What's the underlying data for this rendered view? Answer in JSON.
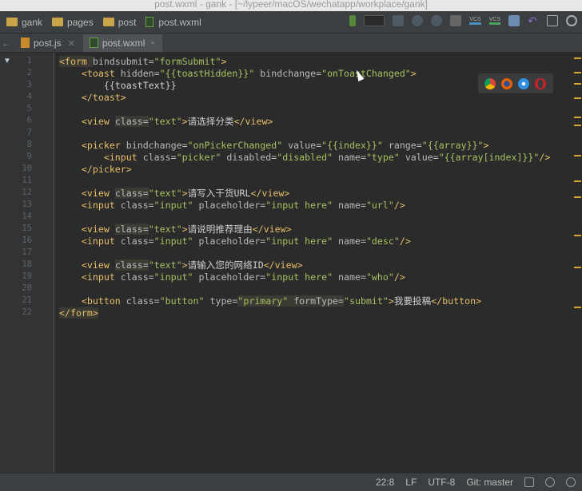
{
  "window": {
    "title": "post.wxml - gank - [~/lypeer/macOS/wechatapp/workplace/gank]"
  },
  "breadcrumb": [
    "gank",
    "pages",
    "post",
    "post.wxml"
  ],
  "tabs": [
    {
      "label": "post.js",
      "active": false
    },
    {
      "label": "post.wxml",
      "active": true
    }
  ],
  "toolbar": {
    "vcs_update": "VCS",
    "vcs_commit": "VCS"
  },
  "code": [
    [
      {
        "t": "<form ",
        "c": "tag hl"
      },
      {
        "t": "bindsubmit=",
        "c": "attr"
      },
      {
        "t": "\"formSubmit\"",
        "c": "str"
      },
      {
        "t": ">",
        "c": "tag"
      }
    ],
    [
      {
        "t": "    <toast ",
        "c": "tag"
      },
      {
        "t": "hidden=",
        "c": "attr"
      },
      {
        "t": "\"{{toastHidden}}\"",
        "c": "str"
      },
      {
        "t": " bindchange=",
        "c": "attr"
      },
      {
        "t": "\"onToastChanged\"",
        "c": "str"
      },
      {
        "t": ">",
        "c": "tag"
      }
    ],
    [
      {
        "t": "        {{toastText}}",
        "c": "txt"
      }
    ],
    [
      {
        "t": "    </toast>",
        "c": "tag"
      }
    ],
    [],
    [
      {
        "t": "    <view ",
        "c": "tag"
      },
      {
        "t": "class=",
        "c": "attr hl"
      },
      {
        "t": "\"text\"",
        "c": "str"
      },
      {
        "t": ">",
        "c": "tag"
      },
      {
        "t": "请选择分类",
        "c": "txt"
      },
      {
        "t": "</view>",
        "c": "tag"
      }
    ],
    [],
    [
      {
        "t": "    <picker ",
        "c": "tag"
      },
      {
        "t": "bindchange=",
        "c": "attr"
      },
      {
        "t": "\"onPickerChanged\"",
        "c": "str"
      },
      {
        "t": " value=",
        "c": "attr"
      },
      {
        "t": "\"{{index}}\"",
        "c": "str"
      },
      {
        "t": " range=",
        "c": "attr"
      },
      {
        "t": "\"{{array}}\"",
        "c": "str"
      },
      {
        "t": ">",
        "c": "tag"
      }
    ],
    [
      {
        "t": "        <input ",
        "c": "tag"
      },
      {
        "t": "class=",
        "c": "attr"
      },
      {
        "t": "\"picker\"",
        "c": "str"
      },
      {
        "t": " disabled=",
        "c": "attr"
      },
      {
        "t": "\"disabled\"",
        "c": "str"
      },
      {
        "t": " name=",
        "c": "attr"
      },
      {
        "t": "\"type\"",
        "c": "str"
      },
      {
        "t": " value=",
        "c": "attr"
      },
      {
        "t": "\"{{array[index]}}\"",
        "c": "str"
      },
      {
        "t": "/>",
        "c": "tag"
      }
    ],
    [
      {
        "t": "    </picker>",
        "c": "tag"
      }
    ],
    [],
    [
      {
        "t": "    <view ",
        "c": "tag"
      },
      {
        "t": "class=",
        "c": "attr hl"
      },
      {
        "t": "\"text\"",
        "c": "str"
      },
      {
        "t": ">",
        "c": "tag"
      },
      {
        "t": "请写入干货URL",
        "c": "txt"
      },
      {
        "t": "</view>",
        "c": "tag"
      }
    ],
    [
      {
        "t": "    <input ",
        "c": "tag"
      },
      {
        "t": "class=",
        "c": "attr"
      },
      {
        "t": "\"input\"",
        "c": "str"
      },
      {
        "t": " placeholder=",
        "c": "attr"
      },
      {
        "t": "\"input here\"",
        "c": "str"
      },
      {
        "t": " name=",
        "c": "attr"
      },
      {
        "t": "\"url\"",
        "c": "str"
      },
      {
        "t": "/>",
        "c": "tag"
      }
    ],
    [],
    [
      {
        "t": "    <view ",
        "c": "tag"
      },
      {
        "t": "class=",
        "c": "attr hl"
      },
      {
        "t": "\"text\"",
        "c": "str"
      },
      {
        "t": ">",
        "c": "tag"
      },
      {
        "t": "请说明推荐理由",
        "c": "txt"
      },
      {
        "t": "</view>",
        "c": "tag"
      }
    ],
    [
      {
        "t": "    <input ",
        "c": "tag"
      },
      {
        "t": "class=",
        "c": "attr"
      },
      {
        "t": "\"input\"",
        "c": "str"
      },
      {
        "t": " placeholder=",
        "c": "attr"
      },
      {
        "t": "\"input here\"",
        "c": "str"
      },
      {
        "t": " name=",
        "c": "attr"
      },
      {
        "t": "\"desc\"",
        "c": "str"
      },
      {
        "t": "/>",
        "c": "tag"
      }
    ],
    [],
    [
      {
        "t": "    <view ",
        "c": "tag"
      },
      {
        "t": "class=",
        "c": "attr hl"
      },
      {
        "t": "\"text\"",
        "c": "str"
      },
      {
        "t": ">",
        "c": "tag"
      },
      {
        "t": "请输入您的网络ID",
        "c": "txt"
      },
      {
        "t": "</view>",
        "c": "tag"
      }
    ],
    [
      {
        "t": "    <input ",
        "c": "tag"
      },
      {
        "t": "class=",
        "c": "attr"
      },
      {
        "t": "\"input\"",
        "c": "str"
      },
      {
        "t": " placeholder=",
        "c": "attr"
      },
      {
        "t": "\"input here\"",
        "c": "str"
      },
      {
        "t": " name=",
        "c": "attr"
      },
      {
        "t": "\"who\"",
        "c": "str"
      },
      {
        "t": "/>",
        "c": "tag"
      }
    ],
    [],
    [
      {
        "t": "    <button ",
        "c": "tag"
      },
      {
        "t": "class=",
        "c": "attr"
      },
      {
        "t": "\"button\"",
        "c": "str"
      },
      {
        "t": " type=",
        "c": "attr"
      },
      {
        "t": "\"primary\"",
        "c": "str hl"
      },
      {
        "t": " formType=",
        "c": "attr hl"
      },
      {
        "t": "\"submit\"",
        "c": "str"
      },
      {
        "t": ">",
        "c": "tag"
      },
      {
        "t": "我要投稿",
        "c": "txt"
      },
      {
        "t": "</button>",
        "c": "tag"
      }
    ],
    [
      {
        "t": "</form>",
        "c": "tag hl"
      }
    ]
  ],
  "status": {
    "position": "22:8",
    "line_sep": "LF",
    "encoding": "UTF-8",
    "vcs": "Git: master"
  },
  "colors": {
    "background": "#2b2b2b",
    "tag": "#e8bf6a",
    "string": "#a5c261"
  }
}
